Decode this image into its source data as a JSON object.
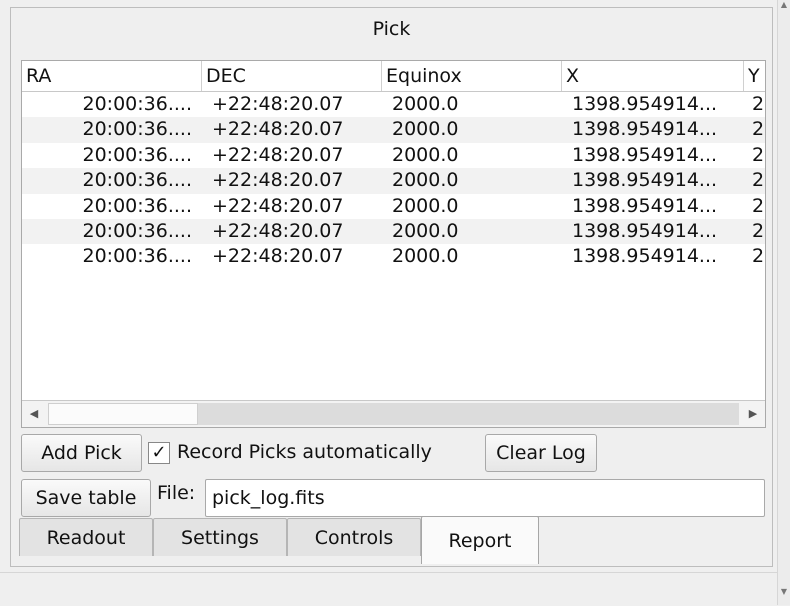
{
  "panel": {
    "title": "Pick"
  },
  "table": {
    "columns": [
      "RA",
      "DEC",
      "Equinox",
      "X",
      "Y"
    ],
    "rows": [
      [
        "20:00:36....",
        "+22:48:20.07",
        "2000.0",
        "1398.954914...",
        "2"
      ],
      [
        "20:00:36....",
        "+22:48:20.07",
        "2000.0",
        "1398.954914...",
        "2"
      ],
      [
        "20:00:36....",
        "+22:48:20.07",
        "2000.0",
        "1398.954914...",
        "2"
      ],
      [
        "20:00:36....",
        "+22:48:20.07",
        "2000.0",
        "1398.954914...",
        "2"
      ],
      [
        "20:00:36....",
        "+22:48:20.07",
        "2000.0",
        "1398.954914...",
        "2"
      ],
      [
        "20:00:36....",
        "+22:48:20.07",
        "2000.0",
        "1398.954914...",
        "2"
      ],
      [
        "20:00:36....",
        "+22:48:20.07",
        "2000.0",
        "1398.954914...",
        "2"
      ]
    ]
  },
  "controls": {
    "add_pick": "Add Pick",
    "record_auto_label": "Record Picks automatically",
    "record_auto_checked": true,
    "clear_log": "Clear Log",
    "save_table": "Save table",
    "file_label": "File:",
    "file_value": "pick_log.fits"
  },
  "tabs": [
    {
      "label": "Readout",
      "active": false
    },
    {
      "label": "Settings",
      "active": false
    },
    {
      "label": "Controls",
      "active": false
    },
    {
      "label": "Report",
      "active": true
    }
  ],
  "icons": {
    "scroll_left": "left-arrow-icon",
    "scroll_right": "right-arrow-icon",
    "check": "checkmark-icon"
  }
}
